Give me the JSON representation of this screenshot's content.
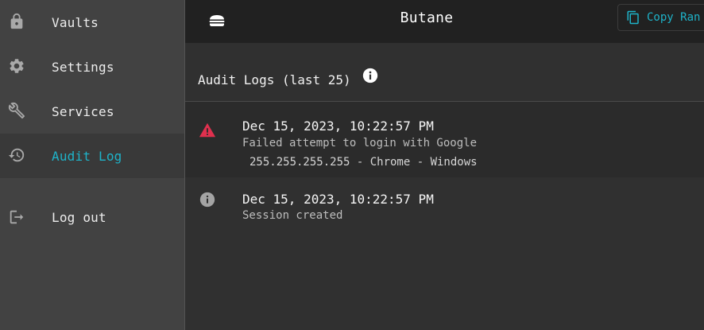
{
  "sidebar": {
    "items": [
      {
        "label": "Vaults",
        "icon": "lock-icon"
      },
      {
        "label": "Settings",
        "icon": "gear-icon"
      },
      {
        "label": "Services",
        "icon": "tools-icon"
      },
      {
        "label": "Audit Log",
        "icon": "history-icon",
        "active": true
      },
      {
        "label": "Log out",
        "icon": "logout-icon"
      }
    ]
  },
  "header": {
    "title": "Butane",
    "copy_button_label": "Copy Ran"
  },
  "main": {
    "section_title": "Audit Logs (last 25)",
    "logs": [
      {
        "level": "warning",
        "timestamp": "Dec 15, 2023, 10:22:57 PM",
        "description": "Failed attempt to login with Google",
        "meta": "255.255.255.255 - Chrome - Windows"
      },
      {
        "level": "info",
        "timestamp": "Dec 15, 2023, 10:22:57 PM",
        "description": "Session created"
      }
    ]
  },
  "colors": {
    "accent": "#1eb3c9",
    "warning": "#e0304e",
    "sidebar_bg": "#424242",
    "header_bg": "#212121",
    "content_bg": "#303030"
  }
}
